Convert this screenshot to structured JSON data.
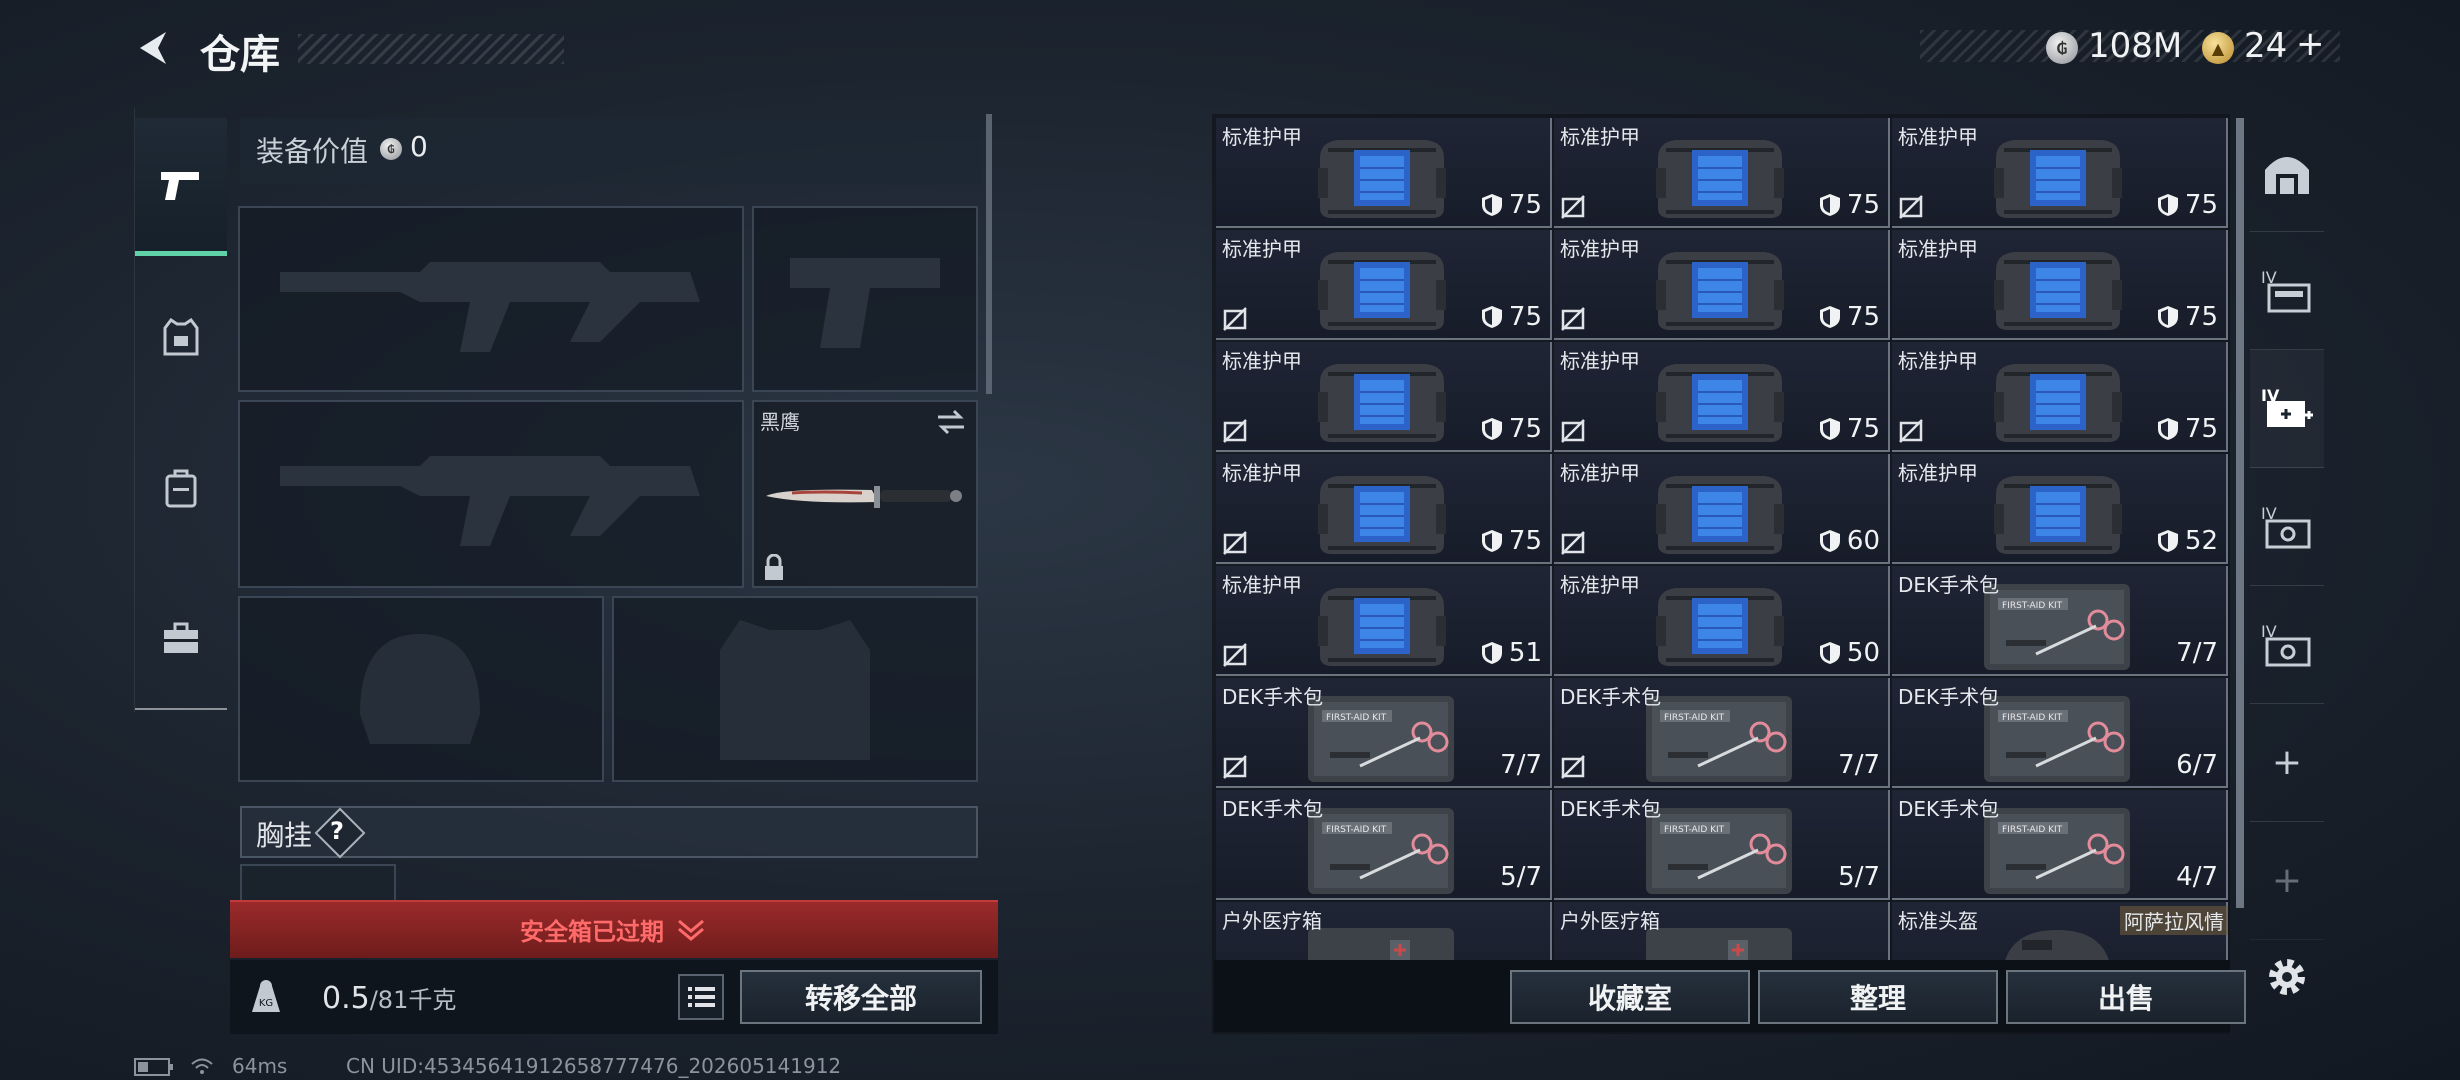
{
  "header": {
    "title": "仓库"
  },
  "currency": {
    "coin_amount": "108M",
    "gold_amount": "24",
    "gold_plus": "+"
  },
  "left_tabs": [
    "weapons",
    "armor",
    "backpack",
    "supplies"
  ],
  "equipment": {
    "value_label": "装备价值",
    "value": "0",
    "melee_name": "黑鹰",
    "chest_label": "胸挂",
    "chest_help": "?"
  },
  "safe_box": {
    "label": "安全箱已过期"
  },
  "weight": {
    "current": "0.5",
    "max": "/81",
    "unit": "千克"
  },
  "buttons": {
    "transfer_all": "转移全部",
    "collection": "收藏室",
    "organize": "整理",
    "sell": "出售"
  },
  "storage": {
    "items": [
      {
        "name": "标准护甲",
        "type": "armor",
        "value": "75",
        "no_insure": false
      },
      {
        "name": "标准护甲",
        "type": "armor",
        "value": "75",
        "no_insure": true
      },
      {
        "name": "标准护甲",
        "type": "armor",
        "value": "75",
        "no_insure": true
      },
      {
        "name": "标准护甲",
        "type": "armor",
        "value": "75",
        "no_insure": true
      },
      {
        "name": "标准护甲",
        "type": "armor",
        "value": "75",
        "no_insure": true
      },
      {
        "name": "标准护甲",
        "type": "armor",
        "value": "75",
        "no_insure": false
      },
      {
        "name": "标准护甲",
        "type": "armor",
        "value": "75",
        "no_insure": true
      },
      {
        "name": "标准护甲",
        "type": "armor",
        "value": "75",
        "no_insure": true
      },
      {
        "name": "标准护甲",
        "type": "armor",
        "value": "75",
        "no_insure": true
      },
      {
        "name": "标准护甲",
        "type": "armor",
        "value": "75",
        "no_insure": true
      },
      {
        "name": "标准护甲",
        "type": "armor",
        "value": "60",
        "no_insure": true
      },
      {
        "name": "标准护甲",
        "type": "armor",
        "value": "52",
        "no_insure": false
      },
      {
        "name": "标准护甲",
        "type": "armor",
        "value": "51",
        "no_insure": true
      },
      {
        "name": "标准护甲",
        "type": "armor",
        "value": "50",
        "no_insure": false
      },
      {
        "name": "DEK手术包",
        "type": "medkit",
        "value": "7/7",
        "no_insure": false
      },
      {
        "name": "DEK手术包",
        "type": "medkit",
        "value": "7/7",
        "no_insure": true
      },
      {
        "name": "DEK手术包",
        "type": "medkit",
        "value": "7/7",
        "no_insure": true
      },
      {
        "name": "DEK手术包",
        "type": "medkit",
        "value": "6/7",
        "no_insure": false
      },
      {
        "name": "DEK手术包",
        "type": "medkit",
        "value": "5/7",
        "no_insure": false
      },
      {
        "name": "DEK手术包",
        "type": "medkit",
        "value": "5/7",
        "no_insure": false
      },
      {
        "name": "DEK手术包",
        "type": "medkit",
        "value": "4/7",
        "no_insure": false
      },
      {
        "name": "户外医疗箱",
        "type": "medbox",
        "value": "",
        "no_insure": false
      },
      {
        "name": "户外医疗箱",
        "type": "medbox",
        "value": "",
        "no_insure": false
      },
      {
        "name": "标准头盔",
        "type": "helmet",
        "value": "",
        "no_insure": false
      }
    ],
    "extra_label": "阿萨拉风情"
  },
  "status": {
    "ping": "64ms",
    "uid": "CN UID:45345641912658777476_202605141912"
  },
  "colors": {
    "accent": "#5fd3a7",
    "danger": "#c23a3a",
    "cell_bg": "#1f2535"
  }
}
